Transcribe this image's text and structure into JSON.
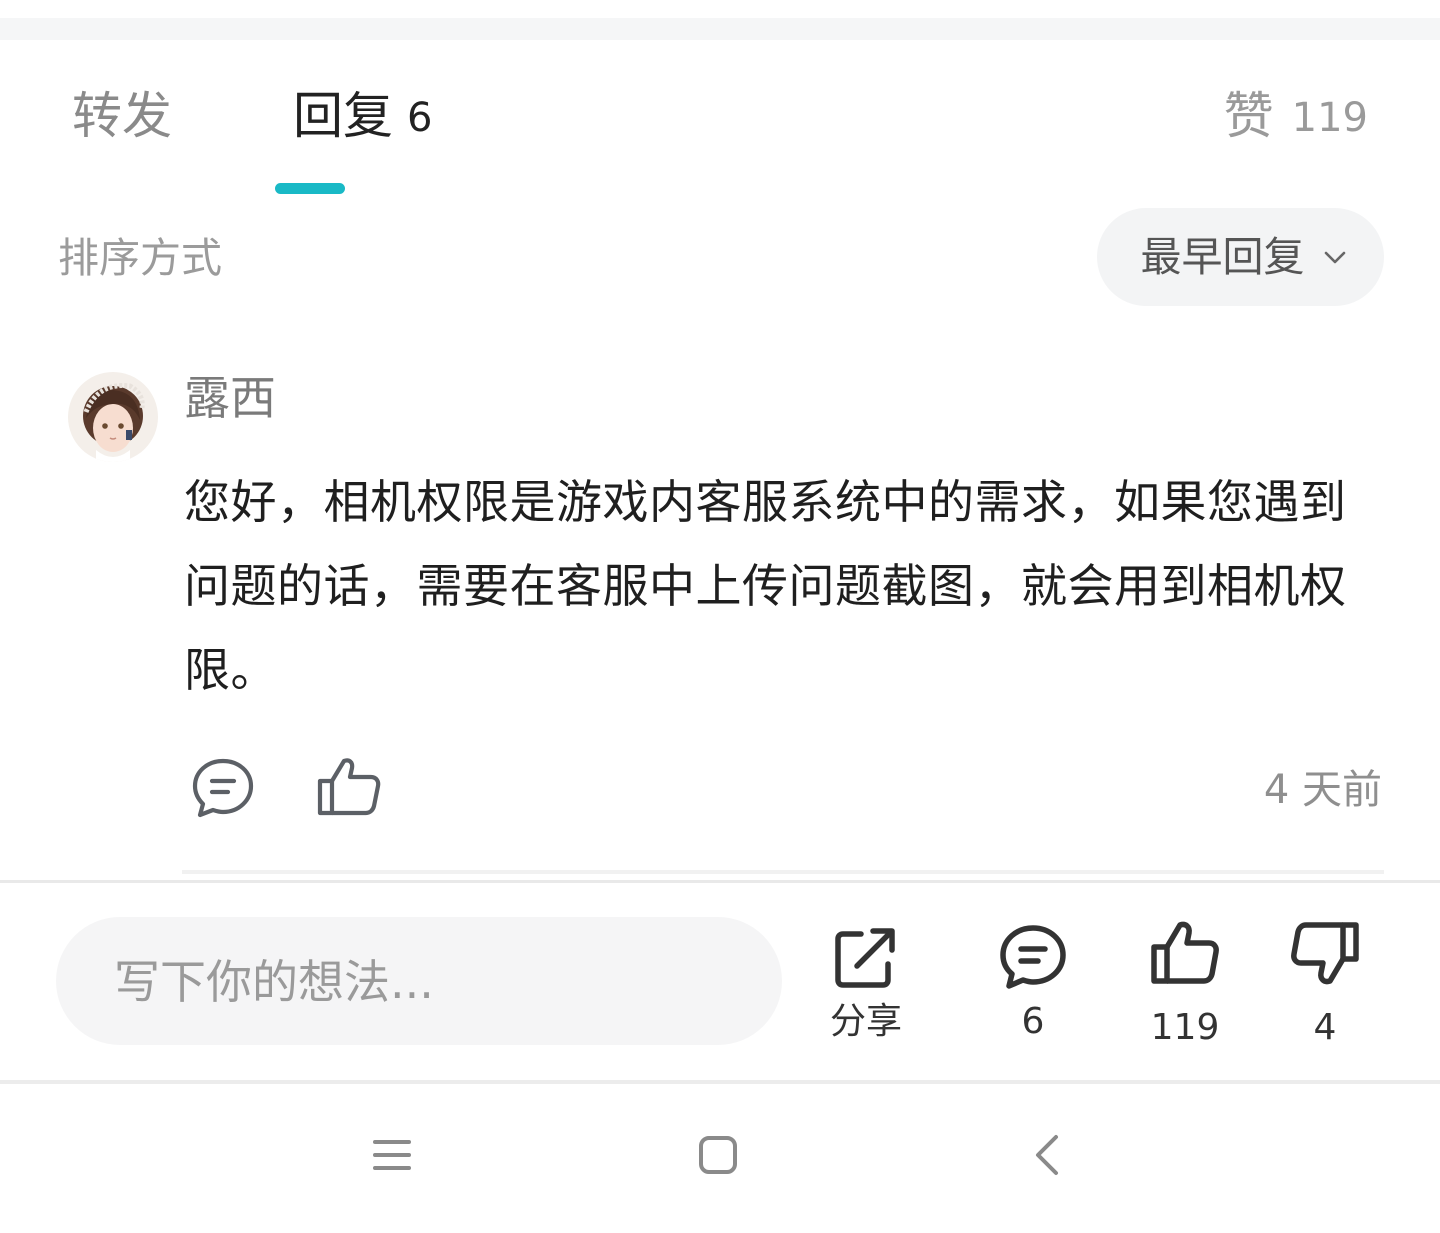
{
  "tabs": {
    "repost_label": "转发",
    "reply_label": "回复",
    "reply_count": "6",
    "like_label": "赞",
    "like_count": "119"
  },
  "sort": {
    "label": "排序方式",
    "selected": "最早回复"
  },
  "comment": {
    "username": "露西",
    "text": "您好，相机权限是游戏内客服系统中的需求，如果您遇到问题的话，需要在客服中上传问题截图，就会用到相机权限。",
    "timestamp": "4 天前"
  },
  "bottom_bar": {
    "input_placeholder": "写下你的想法...",
    "share_label": "分享",
    "comment_count": "6",
    "like_count": "119",
    "dislike_count": "4"
  },
  "colors": {
    "accent": "#19b9c6",
    "icon": "#333333",
    "nav_icon": "#8a8a8a"
  },
  "icons": {
    "reply": "chat-bubble-icon",
    "like": "thumbs-up-icon",
    "dislike": "thumbs-down-icon",
    "share": "share-icon",
    "sort": "chevron-down-icon",
    "nav_menu": "menu-icon",
    "nav_home": "home-icon",
    "nav_back": "back-icon"
  }
}
